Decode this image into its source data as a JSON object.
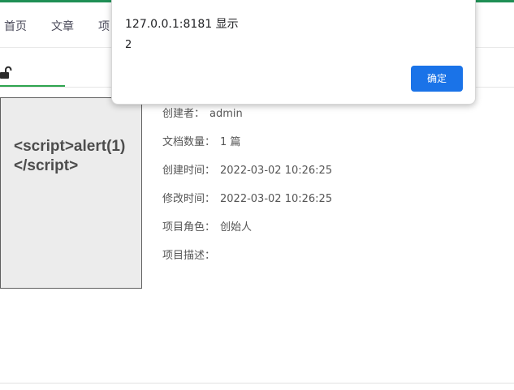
{
  "nav": {
    "items": [
      {
        "label": "首页"
      },
      {
        "label": "文章"
      },
      {
        "label": "项"
      }
    ]
  },
  "tabs": {
    "lock_icon": "unlock-icon"
  },
  "project": {
    "cover_text": "<script>alert(1)\n</script>",
    "info": [
      {
        "label": "创建者：",
        "value": "admin"
      },
      {
        "label": "文档数量：",
        "value": "1 篇"
      },
      {
        "label": "创建时间：",
        "value": "2022-03-02 10:26:25"
      },
      {
        "label": "修改时间：",
        "value": "2022-03-02 10:26:25"
      },
      {
        "label": "项目角色：",
        "value": "创始人"
      },
      {
        "label": "项目描述：",
        "value": ""
      }
    ]
  },
  "dialog": {
    "title": "127.0.0.1:8181 显示",
    "message": "2",
    "ok_label": "确定"
  },
  "colors": {
    "accent_green": "#2ea44f",
    "dialog_button": "#1a73e8"
  }
}
